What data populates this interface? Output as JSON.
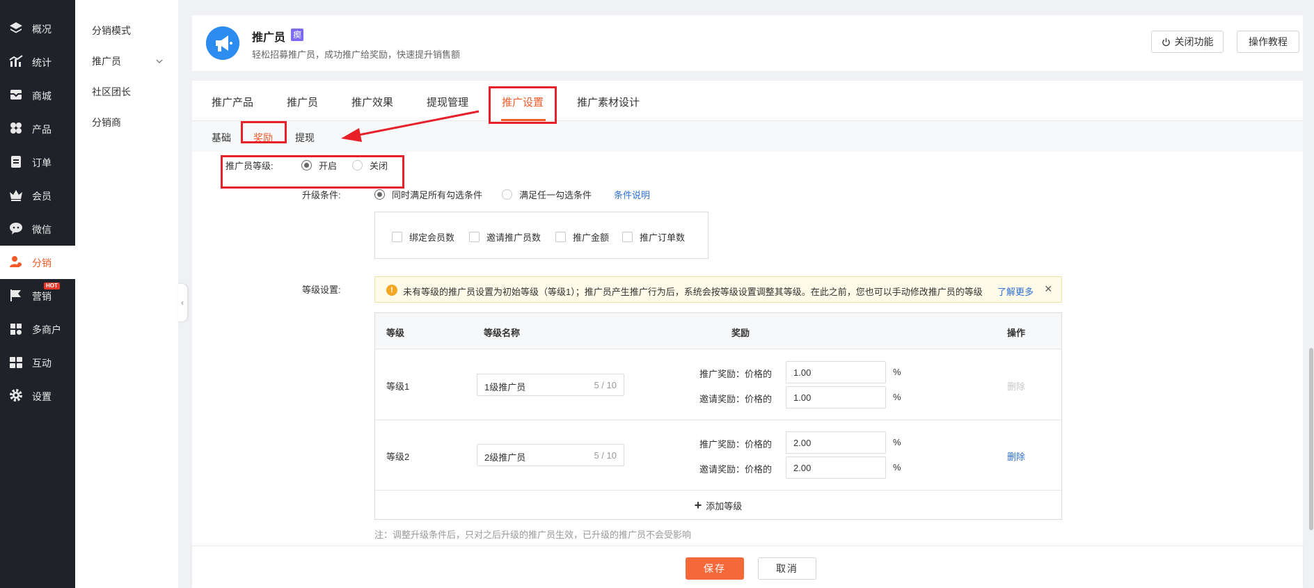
{
  "nav": {
    "items": [
      {
        "label": "概况",
        "icon": "layers-icon"
      },
      {
        "label": "统计",
        "icon": "chart-icon"
      },
      {
        "label": "商城",
        "icon": "mail-icon"
      },
      {
        "label": "产品",
        "icon": "grid-icon"
      },
      {
        "label": "订单",
        "icon": "order-icon"
      },
      {
        "label": "会员",
        "icon": "crown-icon"
      },
      {
        "label": "微信",
        "icon": "wechat-icon"
      },
      {
        "label": "分销",
        "icon": "user-icon"
      },
      {
        "label": "营销",
        "icon": "flag-icon"
      },
      {
        "label": "多商户",
        "icon": "shop-icon"
      },
      {
        "label": "互动",
        "icon": "interact-icon"
      },
      {
        "label": "设置",
        "icon": "gear-icon"
      }
    ],
    "active_label": "分销",
    "hot_badge": "HOT",
    "accent_color": "#f05a28"
  },
  "subnav": {
    "items": [
      {
        "label": "分销模式"
      },
      {
        "label": "推广员"
      },
      {
        "label": "社区团长"
      },
      {
        "label": "分销商"
      }
    ]
  },
  "header": {
    "title": "推广员",
    "badge": "瘈",
    "subtitle": "轻松招募推广员，成功推广给奖励，快速提升销售额",
    "close_feature_label": "关闭功能",
    "tutorial_label": "操作教程"
  },
  "tabs": [
    {
      "label": "推广产品"
    },
    {
      "label": "推广员"
    },
    {
      "label": "推广效果"
    },
    {
      "label": "提现管理"
    },
    {
      "label": "推广设置"
    },
    {
      "label": "推广素材设计"
    }
  ],
  "active_tab": "推广设置",
  "subtabs": [
    {
      "label": "基础"
    },
    {
      "label": "奖励"
    },
    {
      "label": "提现"
    }
  ],
  "active_subtab": "奖励",
  "form": {
    "level_label": "推广员等级:",
    "level_on": "开启",
    "level_off": "关闭",
    "upgrade_label": "升级条件:",
    "upgrade_all": "同时满足所有勾选条件",
    "upgrade_any": "满足任一勾选条件",
    "condition_link": "条件说明",
    "conditions": [
      {
        "label": "绑定会员数"
      },
      {
        "label": "邀请推广员数"
      },
      {
        "label": "推广金额"
      },
      {
        "label": "推广订单数"
      }
    ],
    "level_settings_label": "等级设置:",
    "notice_icon": "!",
    "notice_text": "未有等级的推广员设置为初始等级（等级1）；推广员产生推广行为后，系统会按等级设置调整其等级。在此之前，您也可以手动修改推广员的等级",
    "notice_more": "了解更多",
    "notice_close": "×"
  },
  "table": {
    "headers": {
      "level": "等级",
      "name": "等级名称",
      "reward": "奖励",
      "action": "操作"
    },
    "promo_label": "推广奖励：价格的",
    "invite_label": "邀请奖励：价格的",
    "percent": "%",
    "rows": [
      {
        "level": "等级1",
        "name": "1级推广员",
        "count": "5 / 10",
        "promo": "1.00",
        "invite": "1.00",
        "delete": "删除"
      },
      {
        "level": "等级2",
        "name": "2级推广员",
        "count": "5 / 10",
        "promo": "2.00",
        "invite": "2.00",
        "delete": "删除"
      }
    ],
    "add_plus": "+",
    "add_label": "添加等级"
  },
  "note": "注：调整升级条件后，只对之后升级的推广员生效，已升级的推广员不会受影响",
  "footer": {
    "save_label": "保存",
    "cancel_label": "取消"
  }
}
